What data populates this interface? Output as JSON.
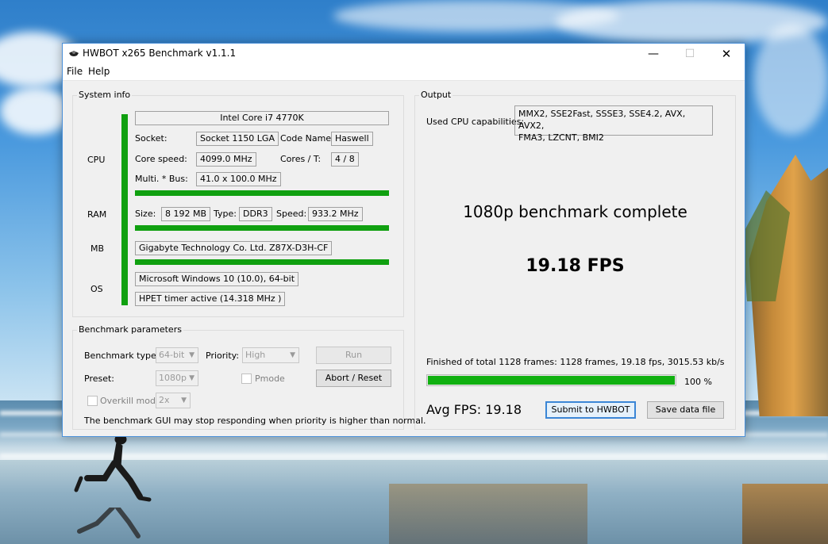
{
  "window": {
    "title": "HWBOT x265 Benchmark v1.1.1",
    "minimize": "—",
    "maximize": "☐",
    "close": "✕"
  },
  "menu": {
    "file": "File",
    "help": "Help"
  },
  "system_info": {
    "title": "System info",
    "cpu_label": "CPU",
    "cpu_name": "Intel Core i7 4770K",
    "socket_label": "Socket:",
    "socket": "Socket 1150 LGA",
    "code_name_label": "Code Name:",
    "code_name": "Haswell",
    "core_speed_label": "Core speed:",
    "core_speed": "4099.0 MHz",
    "cores_label": "Cores / T:",
    "cores": "4 / 8",
    "multi_label": "Multi. * Bus:",
    "multi": "41.0 x 100.0 MHz",
    "ram_label": "RAM",
    "size_label": "Size:",
    "size": "8 192 MB",
    "type_label": "Type:",
    "type": "DDR3",
    "speed_label": "Speed:",
    "speed": "933.2 MHz",
    "mb_label": "MB",
    "mb": "Gigabyte Technology Co. Ltd. Z87X-D3H-CF",
    "os_label": "OS",
    "os": "Microsoft Windows 10 (10.0), 64-bit",
    "timer": "HPET timer active (14.318 MHz )"
  },
  "params": {
    "title": "Benchmark parameters",
    "type_label": "Benchmark type:",
    "type_value": "64-bit",
    "priority_label": "Priority:",
    "priority_value": "High",
    "run_label": "Run",
    "preset_label": "Preset:",
    "preset_value": "1080p",
    "pmode_label": "Pmode",
    "abort_label": "Abort / Reset",
    "overkill_label": "Overkill mode",
    "overkill_value": "2x",
    "warning": "The benchmark GUI may stop responding when priority is higher than normal."
  },
  "output": {
    "title": "Output",
    "capabilities_label": "Used CPU capabilities:",
    "capabilities_line1": "MMX2, SSE2Fast, SSSE3, SSE4.2, AVX, AVX2,",
    "capabilities_line2": "FMA3, LZCNT, BMI2",
    "status": "1080p benchmark complete",
    "fps": "19.18 FPS",
    "finished": "Finished of total 1128 frames: 1128 frames, 19.18 fps,  3015.53 kb/s",
    "progress": 100,
    "progress_text": "100 %",
    "avg_fps": "Avg FPS: 19.18",
    "submit_label": "Submit to HWBOT",
    "save_label": "Save data file"
  },
  "colors": {
    "accent_green": "#10a010",
    "window_border": "#4a90d9"
  },
  "icons": {
    "app": "hwbot-logo-icon",
    "minimize": "minimize-icon",
    "maximize": "maximize-icon",
    "close": "close-icon"
  }
}
